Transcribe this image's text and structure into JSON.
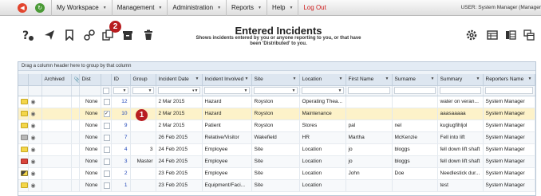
{
  "topnav": {
    "back_icon": "red-back-icon",
    "forward_icon": "green-forward-icon",
    "menus": [
      {
        "label": "My Workspace"
      },
      {
        "label": "Management"
      },
      {
        "label": "Administration"
      },
      {
        "label": "Reports"
      },
      {
        "label": "Help"
      }
    ],
    "logout": "Log Out",
    "user": "USER: System Manager (Manager"
  },
  "toolbar": {
    "icons": [
      "help-icon",
      "send-icon",
      "bookmark-icon",
      "link-icon",
      "copy-icon",
      "archive-icon",
      "delete-icon",
      "gear-icon",
      "export-icon",
      "columns-icon",
      "windows-icon"
    ],
    "title": "Entered Incidents",
    "subtitle_line1": "Shows incidents entered by you or anyone reporting to you, or that have",
    "subtitle_line2": "been 'Distributed' to you.",
    "badge_2": "2",
    "badge_1": "1"
  },
  "grid": {
    "group_hint": "Drag a column header here to group by that column",
    "headers": {
      "archived": "Archived",
      "dist": "Dist",
      "id": "ID",
      "group": "Group",
      "incident_date": "Incident Date",
      "incident_involved": "Incident Involved",
      "site": "Site",
      "location": "Location",
      "first_name": "First Name",
      "surname": "Surname",
      "summary": "Summary",
      "reporters_name": "Reporters Name"
    },
    "rows": [
      {
        "status": "yellow",
        "archived": "None",
        "dist": "",
        "id": "12",
        "group": "",
        "date": "2 Mar 2015",
        "involved": "Hazard",
        "site": "Royston",
        "location": "Operating Thea...",
        "first": "",
        "surname": "",
        "summary": "water on veran...",
        "reporter": "System Manager"
      },
      {
        "status": "yellow",
        "archived": "None",
        "dist": "✓",
        "id": "10",
        "group": "",
        "date": "2 Mar 2015",
        "involved": "Hazard",
        "site": "Royston",
        "location": "Maintenance",
        "first": "",
        "surname": "",
        "summary": "aaasaaaaa",
        "reporter": "System Manager"
      },
      {
        "status": "yellow",
        "archived": "None",
        "dist": "",
        "id": "9",
        "group": "",
        "date": "2 Mar 2015",
        "involved": "Patient",
        "site": "Royston",
        "location": "Stores",
        "first": "pal",
        "surname": "nel",
        "summary": "kugiugfihljol",
        "reporter": "System Manager"
      },
      {
        "status": "grey",
        "archived": "None",
        "dist": "",
        "id": "7",
        "group": "",
        "date": "26 Feb 2015",
        "involved": "Relative/Visitor",
        "site": "Wakefield",
        "location": "HR",
        "first": "Martha",
        "surname": "McKenzie",
        "summary": "Fell into lift",
        "reporter": "System Manager"
      },
      {
        "status": "yellow",
        "archived": "None",
        "dist": "",
        "id": "4",
        "group": "3",
        "date": "24 Feb 2015",
        "involved": "Employee",
        "site": "Site",
        "location": "Location",
        "first": "jo",
        "surname": "bloggs",
        "summary": "fell down lift shaft",
        "reporter": "System Manager"
      },
      {
        "status": "red",
        "archived": "None",
        "dist": "",
        "id": "3",
        "group": "Master",
        "date": "24 Feb 2015",
        "involved": "Employee",
        "site": "Site",
        "location": "Location",
        "first": "jo",
        "surname": "bloggs",
        "summary": "fell down lift shaft",
        "reporter": "System Manager"
      },
      {
        "status": "mixed",
        "archived": "None",
        "dist": "",
        "id": "2",
        "group": "",
        "date": "23 Feb 2015",
        "involved": "Employee",
        "site": "Site",
        "location": "Location",
        "first": "John",
        "surname": "Doe",
        "summary": "Needlestick dur...",
        "reporter": "System Manager"
      },
      {
        "status": "yellow",
        "archived": "None",
        "dist": "",
        "id": "1",
        "group": "",
        "date": "23 Feb 2015",
        "involved": "Equipment/Faci...",
        "site": "Site",
        "location": "Location",
        "first": "",
        "surname": "",
        "summary": "test",
        "reporter": "System Manager"
      }
    ],
    "selected_row_index": 1
  }
}
